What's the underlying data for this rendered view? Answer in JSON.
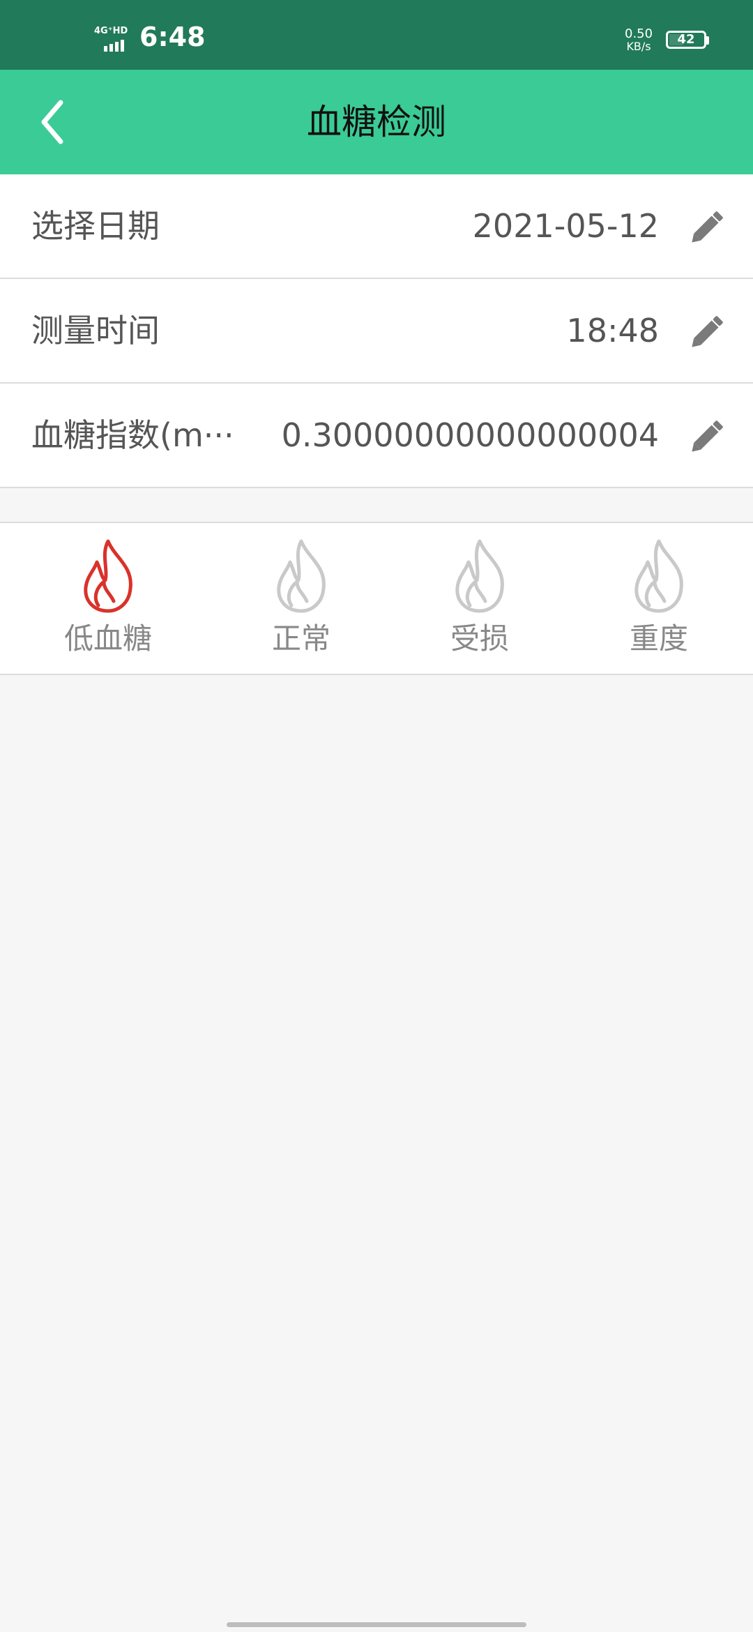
{
  "status_bar": {
    "network": "4G⁺HD",
    "time": "6:48",
    "speed_value": "0.50",
    "speed_unit": "KB/s",
    "battery": "42",
    "battery_level_percent": 42
  },
  "header": {
    "title": "血糖检测",
    "back_icon": "chevron-left-icon"
  },
  "form": {
    "rows": [
      {
        "label": "选择日期",
        "value": "2021-05-12",
        "icon": "pencil-icon"
      },
      {
        "label": "测量时间",
        "value": "18:48",
        "icon": "pencil-icon"
      },
      {
        "label": "血糖指数(m···",
        "value": "0.30000000000000004",
        "icon": "pencil-icon"
      }
    ]
  },
  "levels": {
    "items": [
      {
        "label": "低血糖",
        "icon": "flame-icon",
        "active": true
      },
      {
        "label": "正常",
        "icon": "flame-icon",
        "active": false
      },
      {
        "label": "受损",
        "icon": "flame-icon",
        "active": false
      },
      {
        "label": "重度",
        "icon": "flame-icon",
        "active": false
      }
    ],
    "active_color": "#d9322b",
    "inactive_color": "#c9c9c9"
  },
  "colors": {
    "status_bar": "#217a59",
    "header": "#3bcb96",
    "background": "#f6f6f6"
  }
}
